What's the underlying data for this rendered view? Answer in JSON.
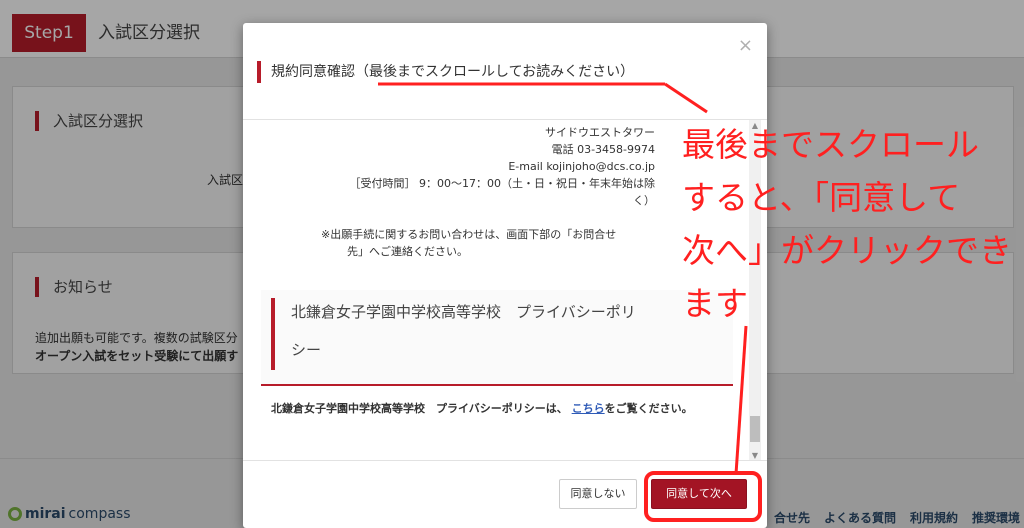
{
  "header": {
    "step_badge": "Step1",
    "step_title": "入試区分選択"
  },
  "card1": {
    "title": "入試区分選択",
    "label": "入試区"
  },
  "card2": {
    "title": "お知らせ",
    "line1": "追加出願も可能です。複数の試験区分",
    "line2": "オープン入試をセット受験にて出願す"
  },
  "footer": {
    "logo_brand": "mirai",
    "logo_suffix": "compass",
    "links": [
      "合せ先",
      "よくある質問",
      "利用規約",
      "推奨環境"
    ]
  },
  "modal": {
    "close_glyph": "×",
    "title": "規約同意確認（最後までスクロールしてお読みください）",
    "address_lines": [
      "サイドウエストタワー",
      "電話 03-3458-9974",
      "E-mail kojinjoho@dcs.co.jp"
    ],
    "hours_line1": "［受付時間］ 9：00〜17：00（土・日・祝日・年末年始は除",
    "hours_line2": "く）",
    "note_line1": "※出願手続に関するお問い合わせは、画面下部の「お問合せ",
    "note_line2": "先」へご連絡ください。",
    "privacy_title_line1": "北鎌倉女子学園中学校高等学校　プライバシーポリ",
    "privacy_title_line2": "シー",
    "privacy_text_before": "北鎌倉女子学園中学校高等学校　プライバシーポリシーは、",
    "privacy_link": "こちら",
    "privacy_text_after": "をご覧ください。",
    "disagree_label": "同意しない",
    "agree_label": "同意して次へ"
  },
  "annotation": {
    "line1": "最後までスクロール",
    "line2": "すると、「同意して",
    "line3": "次へ」がクリックでき",
    "line4": "ます",
    "color": "#ff2020"
  },
  "colors": {
    "accent": "#b71c2a",
    "agree_button": "#a31424"
  }
}
